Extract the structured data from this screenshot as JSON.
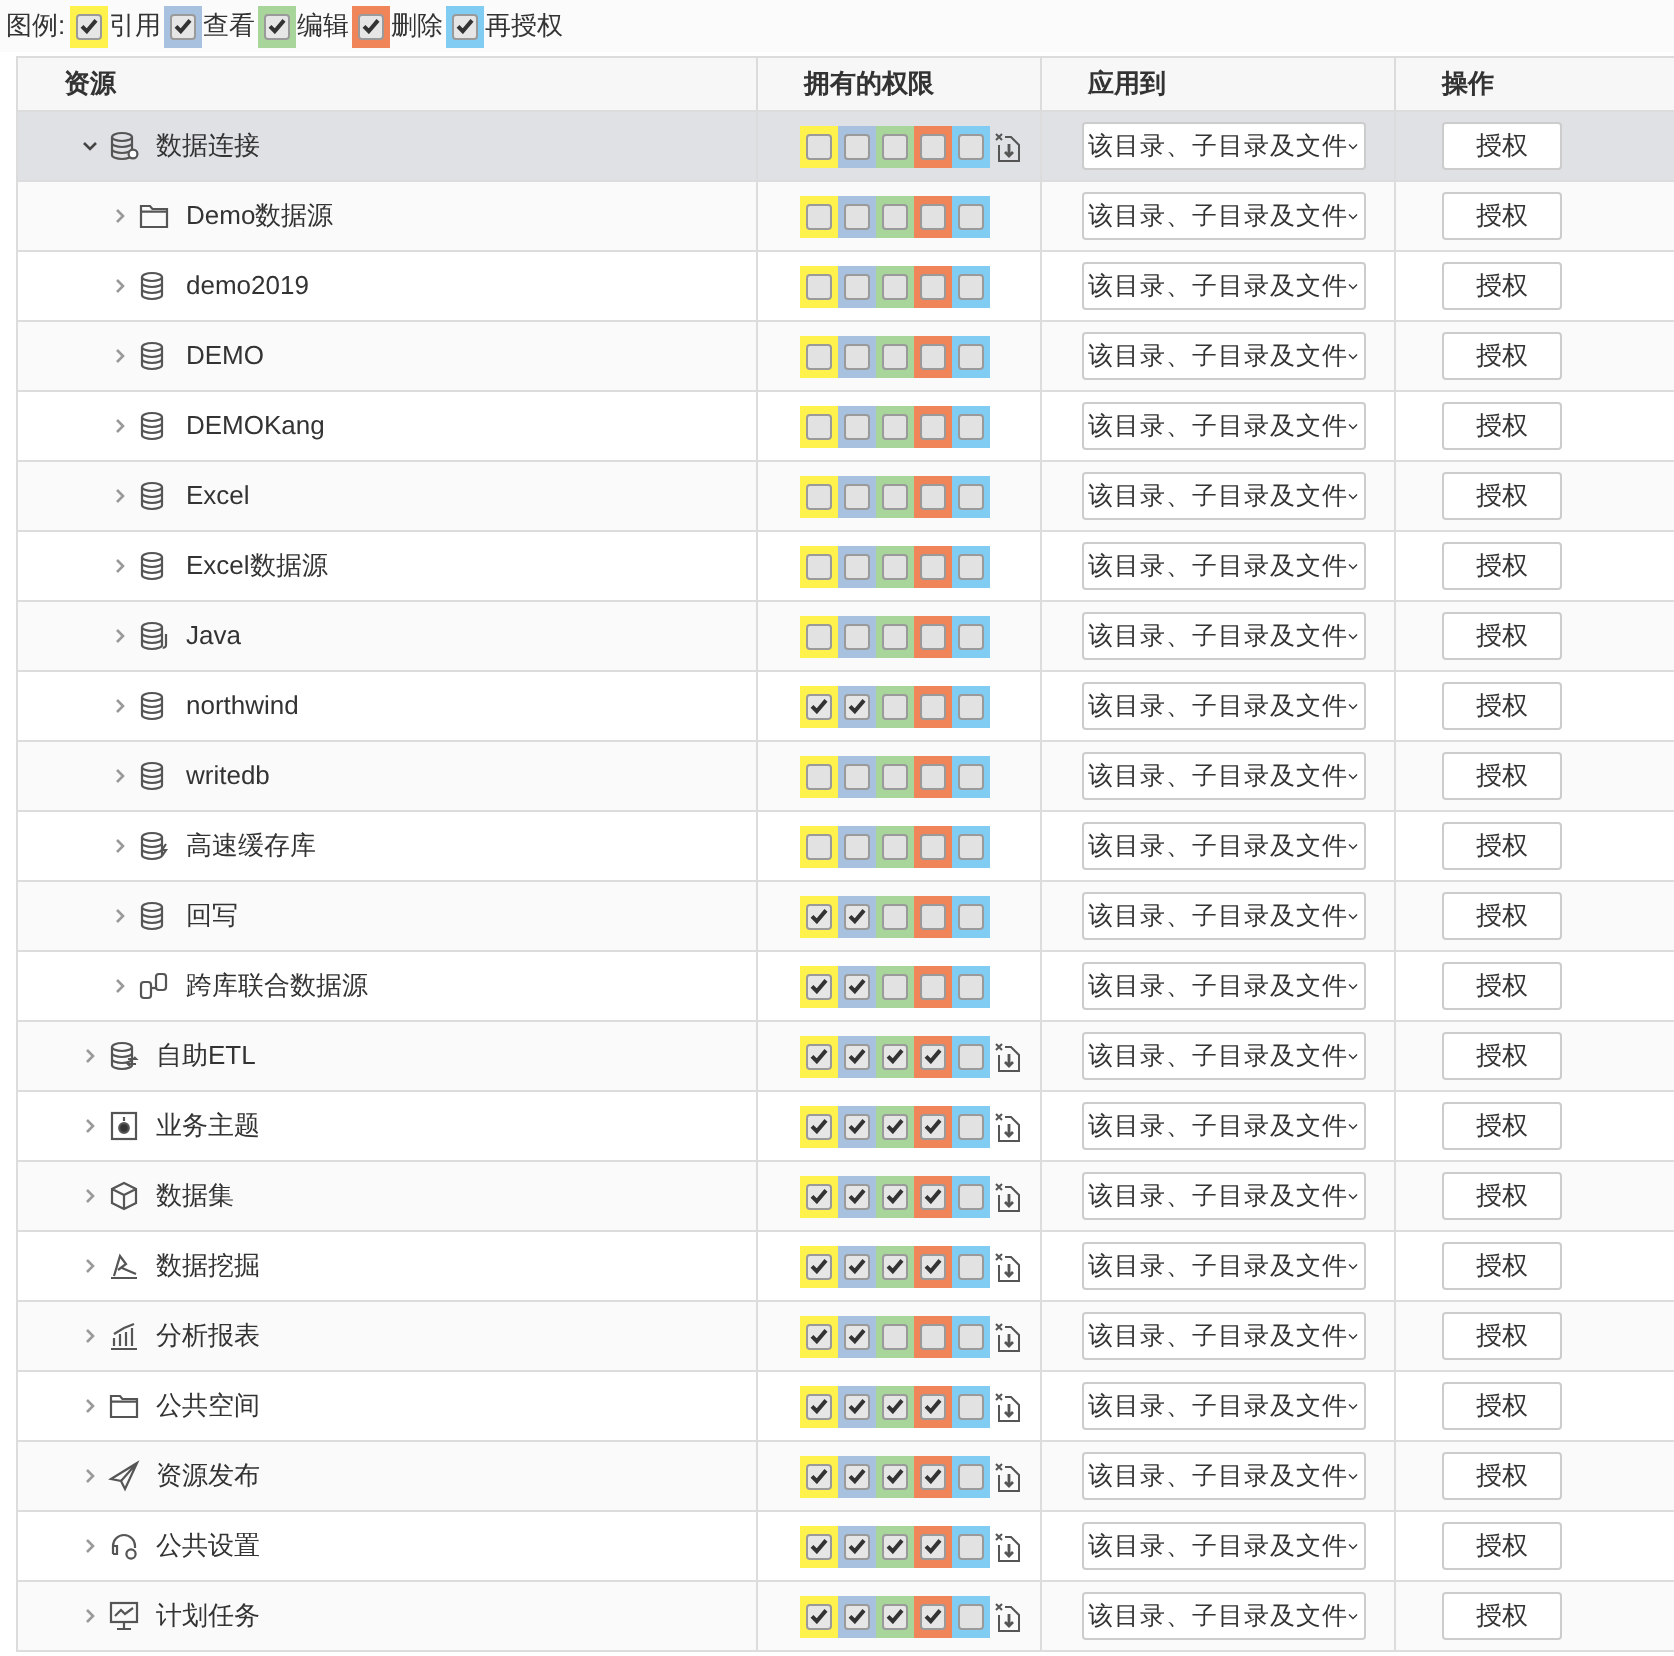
{
  "legend": {
    "label": "图例:",
    "items": [
      {
        "label": "引用",
        "checked": true
      },
      {
        "label": "查看",
        "checked": true
      },
      {
        "label": "编辑",
        "checked": true
      },
      {
        "label": "删除",
        "checked": true
      },
      {
        "label": "再授权",
        "checked": true
      }
    ]
  },
  "table": {
    "columns": [
      "资源",
      "拥有的权限",
      "应用到",
      "操作"
    ],
    "rows": [
      {
        "name": "数据连接",
        "kind": "db-gear",
        "selected": true,
        "expanded": true,
        "perms": [
          false,
          false,
          false,
          false,
          false
        ],
        "reset_icon": true,
        "apply": "该目录、子目录及文件",
        "action": "授权",
        "children": [
          {
            "name": "Demo数据源",
            "kind": "folder",
            "selected": false,
            "expanded": false,
            "perms": [
              false,
              false,
              false,
              false,
              false
            ],
            "reset_icon": false,
            "apply": "该目录、子目录及文件",
            "action": "授权"
          },
          {
            "name": "demo2019",
            "kind": "database",
            "selected": false,
            "expanded": false,
            "perms": [
              false,
              false,
              false,
              false,
              false
            ],
            "reset_icon": false,
            "apply": "该目录、子目录及文件",
            "action": "授权"
          },
          {
            "name": "DEMO",
            "kind": "database",
            "selected": false,
            "expanded": false,
            "perms": [
              false,
              false,
              false,
              false,
              false
            ],
            "reset_icon": false,
            "apply": "该目录、子目录及文件",
            "action": "授权"
          },
          {
            "name": "DEMOKang",
            "kind": "database",
            "selected": false,
            "expanded": false,
            "perms": [
              false,
              false,
              false,
              false,
              false
            ],
            "reset_icon": false,
            "apply": "该目录、子目录及文件",
            "action": "授权"
          },
          {
            "name": "Excel",
            "kind": "database",
            "selected": false,
            "expanded": false,
            "perms": [
              false,
              false,
              false,
              false,
              false
            ],
            "reset_icon": false,
            "apply": "该目录、子目录及文件",
            "action": "授权"
          },
          {
            "name": "Excel数据源",
            "kind": "database",
            "selected": false,
            "expanded": false,
            "perms": [
              false,
              false,
              false,
              false,
              false
            ],
            "reset_icon": false,
            "apply": "该目录、子目录及文件",
            "action": "授权"
          },
          {
            "name": "Java",
            "kind": "db-java",
            "selected": false,
            "expanded": false,
            "perms": [
              false,
              false,
              false,
              false,
              false
            ],
            "reset_icon": false,
            "apply": "该目录、子目录及文件",
            "action": "授权"
          },
          {
            "name": "northwind",
            "kind": "database",
            "selected": false,
            "expanded": false,
            "perms": [
              true,
              true,
              false,
              false,
              false
            ],
            "reset_icon": false,
            "apply": "该目录、子目录及文件",
            "action": "授权"
          },
          {
            "name": "writedb",
            "kind": "database",
            "selected": false,
            "expanded": false,
            "perms": [
              false,
              false,
              false,
              false,
              false
            ],
            "reset_icon": false,
            "apply": "该目录、子目录及文件",
            "action": "授权"
          },
          {
            "name": "高速缓存库",
            "kind": "db-bolt",
            "selected": false,
            "expanded": false,
            "perms": [
              false,
              false,
              false,
              false,
              false
            ],
            "reset_icon": false,
            "apply": "该目录、子目录及文件",
            "action": "授权"
          },
          {
            "name": "回写",
            "kind": "database",
            "selected": false,
            "expanded": false,
            "perms": [
              true,
              true,
              false,
              false,
              false
            ],
            "reset_icon": false,
            "apply": "该目录、子目录及文件",
            "action": "授权"
          },
          {
            "name": "跨库联合数据源",
            "kind": "db-link",
            "selected": false,
            "expanded": false,
            "perms": [
              true,
              true,
              false,
              false,
              false
            ],
            "reset_icon": false,
            "apply": "该目录、子目录及文件",
            "action": "授权"
          }
        ]
      },
      {
        "name": "自助ETL",
        "kind": "db-sync",
        "selected": false,
        "expanded": false,
        "perms": [
          true,
          true,
          true,
          true,
          false
        ],
        "reset_icon": true,
        "apply": "该目录、子目录及文件",
        "action": "授权"
      },
      {
        "name": "业务主题",
        "kind": "subject",
        "selected": false,
        "expanded": false,
        "perms": [
          true,
          true,
          true,
          true,
          false
        ],
        "reset_icon": true,
        "apply": "该目录、子目录及文件",
        "action": "授权"
      },
      {
        "name": "数据集",
        "kind": "cube",
        "selected": false,
        "expanded": false,
        "perms": [
          true,
          true,
          true,
          true,
          false
        ],
        "reset_icon": true,
        "apply": "该目录、子目录及文件",
        "action": "授权"
      },
      {
        "name": "数据挖掘",
        "kind": "mining",
        "selected": false,
        "expanded": false,
        "perms": [
          true,
          true,
          true,
          true,
          false
        ],
        "reset_icon": true,
        "apply": "该目录、子目录及文件",
        "action": "授权"
      },
      {
        "name": "分析报表",
        "kind": "report",
        "selected": false,
        "expanded": false,
        "perms": [
          true,
          true,
          false,
          false,
          false
        ],
        "reset_icon": true,
        "apply": "该目录、子目录及文件",
        "action": "授权"
      },
      {
        "name": "公共空间",
        "kind": "folder",
        "selected": false,
        "expanded": false,
        "perms": [
          true,
          true,
          true,
          true,
          false
        ],
        "reset_icon": true,
        "apply": "该目录、子目录及文件",
        "action": "授权"
      },
      {
        "name": "资源发布",
        "kind": "publish",
        "selected": false,
        "expanded": false,
        "perms": [
          true,
          true,
          true,
          true,
          false
        ],
        "reset_icon": true,
        "apply": "该目录、子目录及文件",
        "action": "授权"
      },
      {
        "name": "公共设置",
        "kind": "settings",
        "selected": false,
        "expanded": false,
        "perms": [
          true,
          true,
          true,
          true,
          false
        ],
        "reset_icon": true,
        "apply": "该目录、子目录及文件",
        "action": "授权"
      },
      {
        "name": "计划任务",
        "kind": "schedule",
        "selected": false,
        "expanded": false,
        "perms": [
          true,
          true,
          true,
          true,
          false
        ],
        "reset_icon": true,
        "apply": "该目录、子目录及文件",
        "action": "授权"
      }
    ]
  }
}
